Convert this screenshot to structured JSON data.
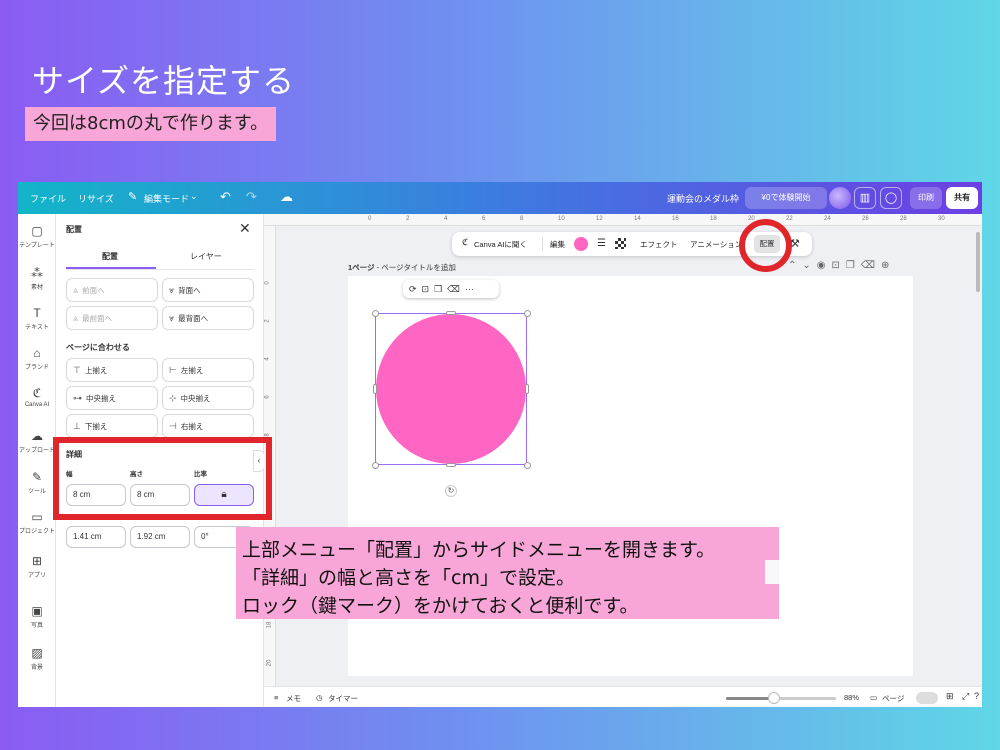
{
  "slide": {
    "title": "サイズを指定する",
    "subtitle": "今回は8cmの丸で作ります。"
  },
  "topbar": {
    "file": "ファイル",
    "resize": "リサイズ",
    "edit_mode": "編集モード",
    "doc_title": "運動会のメダル枠",
    "trial": "¥0で体験開始",
    "print": "印刷",
    "share": "共有"
  },
  "rail": [
    {
      "icon": "template-icon",
      "glyph": "▢",
      "label": "テンプレート"
    },
    {
      "icon": "elements-icon",
      "glyph": "⁂",
      "label": "素材"
    },
    {
      "icon": "text-icon",
      "glyph": "T",
      "label": "テキスト"
    },
    {
      "icon": "brand-icon",
      "glyph": "⌂",
      "label": "ブランド"
    },
    {
      "icon": "canva-ai-icon",
      "glyph": "ℭ",
      "label": "Canva AI"
    },
    {
      "icon": "upload-icon",
      "glyph": "☁",
      "label": "アップロード"
    },
    {
      "icon": "tools-icon",
      "glyph": "✎",
      "label": "ツール"
    },
    {
      "icon": "project-icon",
      "glyph": "▭",
      "label": "プロジェクト"
    },
    {
      "icon": "apps-icon",
      "glyph": "⊞",
      "label": "アプリ"
    },
    {
      "icon": "photo-icon",
      "glyph": "▣",
      "label": "写真"
    },
    {
      "icon": "background-icon",
      "glyph": "▨",
      "label": "背景"
    }
  ],
  "panel": {
    "title": "配置",
    "tab_arrange": "配置",
    "tab_layers": "レイヤー",
    "forward": "前面へ",
    "backward": "背面へ",
    "to_front": "最前面へ",
    "to_back": "最背面へ",
    "align_section": "ページに合わせる",
    "align_top": "上揃え",
    "align_left": "左揃え",
    "align_middle": "中央揃え",
    "align_center": "中央揃え",
    "align_bottom": "下揃え",
    "align_right": "右揃え",
    "detail_section": "詳細",
    "width_label": "幅",
    "height_label": "高さ",
    "ratio_label": "比率",
    "width_value": "8 cm",
    "height_value": "8 cm",
    "x_value": "1.41 cm",
    "y_value": "1.92 cm",
    "rotation_value": "0°"
  },
  "ruler": {
    "top": [
      "0",
      "2",
      "4",
      "6",
      "8",
      "10",
      "12",
      "14",
      "16",
      "18",
      "20",
      "22",
      "24",
      "26",
      "28",
      "30"
    ],
    "left": [
      "0",
      "2",
      "4",
      "6",
      "8",
      "10",
      "12",
      "14",
      "16",
      "18",
      "20"
    ]
  },
  "context_toolbar": {
    "ai": "Canva AIに聞く",
    "edit": "編集",
    "effect": "エフェクト",
    "animation": "アニメーション",
    "arrange": "配置"
  },
  "page": {
    "label": "1ページ",
    "placeholder": "- ページタイトルを追加"
  },
  "bottombar": {
    "memo": "メモ",
    "timer": "タイマー",
    "zoom": "88%",
    "pages": "ページ"
  },
  "zoom_fraction": 0.44,
  "colors": {
    "shape_fill": "#ff66c4",
    "selection": "#9b6cf6",
    "annotation_red": "#e0262b",
    "callout_bg": "#f8a6d8"
  },
  "callout": {
    "line1": "上部メニュー「配置」からサイドメニューを開きます。",
    "line2": "「詳細」の幅と高さを「cm」で設定。",
    "line3": "ロック（鍵マーク）をかけておくと便利です。"
  }
}
